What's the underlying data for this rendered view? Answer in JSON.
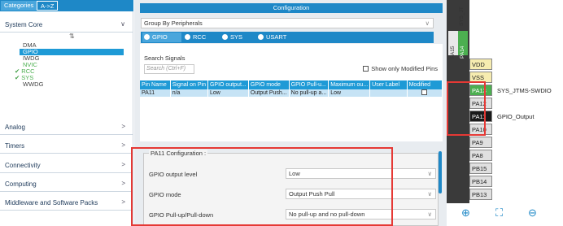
{
  "left": {
    "tab_categories": "Categories",
    "tab_az": "A->Z",
    "system_core": "System Core",
    "core_items": [
      {
        "label": "DMA",
        "style": "plain"
      },
      {
        "label": "GPIO",
        "style": "selected"
      },
      {
        "label": "IWDG",
        "style": "plain"
      },
      {
        "label": "NVIC",
        "style": "green-text"
      },
      {
        "label": "RCC",
        "style": "checked"
      },
      {
        "label": "SYS",
        "style": "checked"
      },
      {
        "label": "WWDG",
        "style": "plain"
      }
    ],
    "categories": [
      "Analog",
      "Timers",
      "Connectivity",
      "Computing",
      "Middleware and Software Packs"
    ]
  },
  "config": {
    "title": "Configuration",
    "group_by": "Group By Peripherals",
    "tabs": [
      "GPIO",
      "RCC",
      "SYS",
      "USART"
    ],
    "search_label": "Search Signals",
    "search_placeholder": "Search (Ctrl+F)",
    "show_modified": "Show only Modified Pins",
    "table_headers": [
      "Pin Name",
      "Signal on Pin",
      "GPIO output...",
      "GPIO mode",
      "GPIO Pull-u...",
      "Maximum ou...",
      "User Label",
      "Modified"
    ],
    "table_row": [
      "PA11",
      "n/a",
      "Low",
      "Output Push...",
      "No pull-up a...",
      "Low",
      ""
    ],
    "pa11_title": "PA11 Configuration :",
    "props": [
      {
        "label": "GPIO output level",
        "value": "Low"
      },
      {
        "label": "GPIO mode",
        "value": "Output Push Pull"
      },
      {
        "label": "GPIO Pull-up/Pull-down",
        "value": "No pull-up and no pull-down"
      }
    ]
  },
  "chip": {
    "sys_jt": "SYS_JT",
    "top_pins": [
      "PA15",
      "PA14"
    ],
    "pins": [
      {
        "name": "VDD",
        "color": "#f6ecb0",
        "label": ""
      },
      {
        "name": "VSS",
        "color": "#f6ecb0",
        "label": ""
      },
      {
        "name": "PA13",
        "color": "#4caf50",
        "label": "SYS_JTMS-SWDIO"
      },
      {
        "name": "PA12",
        "color": "#e0e0e0",
        "label": ""
      },
      {
        "name": "PA11",
        "color": "#1a1a1a",
        "label": "GPIO_Output"
      },
      {
        "name": "PA10",
        "color": "#e0e0e0",
        "label": ""
      },
      {
        "name": "PA9",
        "color": "#e0e0e0",
        "label": ""
      },
      {
        "name": "PA8",
        "color": "#e0e0e0",
        "label": ""
      },
      {
        "name": "PB15",
        "color": "#e0e0e0",
        "label": ""
      },
      {
        "name": "PB14",
        "color": "#e0e0e0",
        "label": ""
      },
      {
        "name": "PB13",
        "color": "#e0e0e0",
        "label": ""
      }
    ],
    "icons": [
      "zoom-in-icon",
      "fit-icon",
      "zoom-out-icon"
    ]
  }
}
